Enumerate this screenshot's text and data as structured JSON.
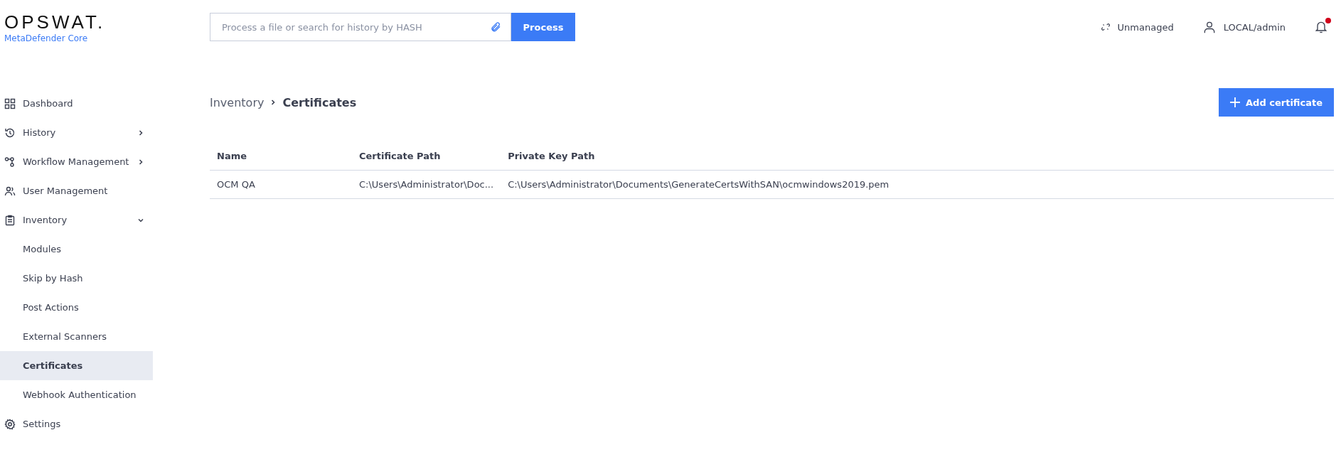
{
  "header": {
    "logo": "OPSWAT.",
    "product": "MetaDefender Core",
    "search": {
      "placeholder": "Process a file or search for history by HASH"
    },
    "process_button": "Process",
    "status": "Unmanaged",
    "user": "LOCAL/admin",
    "notification_unread": true
  },
  "sidebar": {
    "items": [
      {
        "label": "Dashboard",
        "selected": false
      },
      {
        "label": "History",
        "selected": false,
        "expanded": false
      },
      {
        "label": "Workflow Management",
        "selected": false,
        "expanded": false
      },
      {
        "label": "User Management",
        "selected": false
      },
      {
        "label": "Inventory",
        "selected": false,
        "expanded": true,
        "children": [
          {
            "label": "Modules",
            "selected": false
          },
          {
            "label": "Skip by Hash",
            "selected": false
          },
          {
            "label": "Post Actions",
            "selected": false
          },
          {
            "label": "External Scanners",
            "selected": false
          },
          {
            "label": "Certificates",
            "selected": true
          },
          {
            "label": "Webhook Authentication",
            "selected": false
          }
        ]
      },
      {
        "label": "Settings",
        "selected": false
      }
    ]
  },
  "breadcrumb": [
    "Inventory",
    "Certificates"
  ],
  "add_button": "Add certificate",
  "table": {
    "columns": [
      "Name",
      "Certificate Path",
      "Private Key Path"
    ],
    "rows": [
      [
        "OCM QA",
        "C:\\Users\\Administrator\\Doc...",
        "C:\\Users\\Administrator\\Documents\\GenerateCertsWithSAN\\ocmwindows2019.pem"
      ]
    ]
  }
}
